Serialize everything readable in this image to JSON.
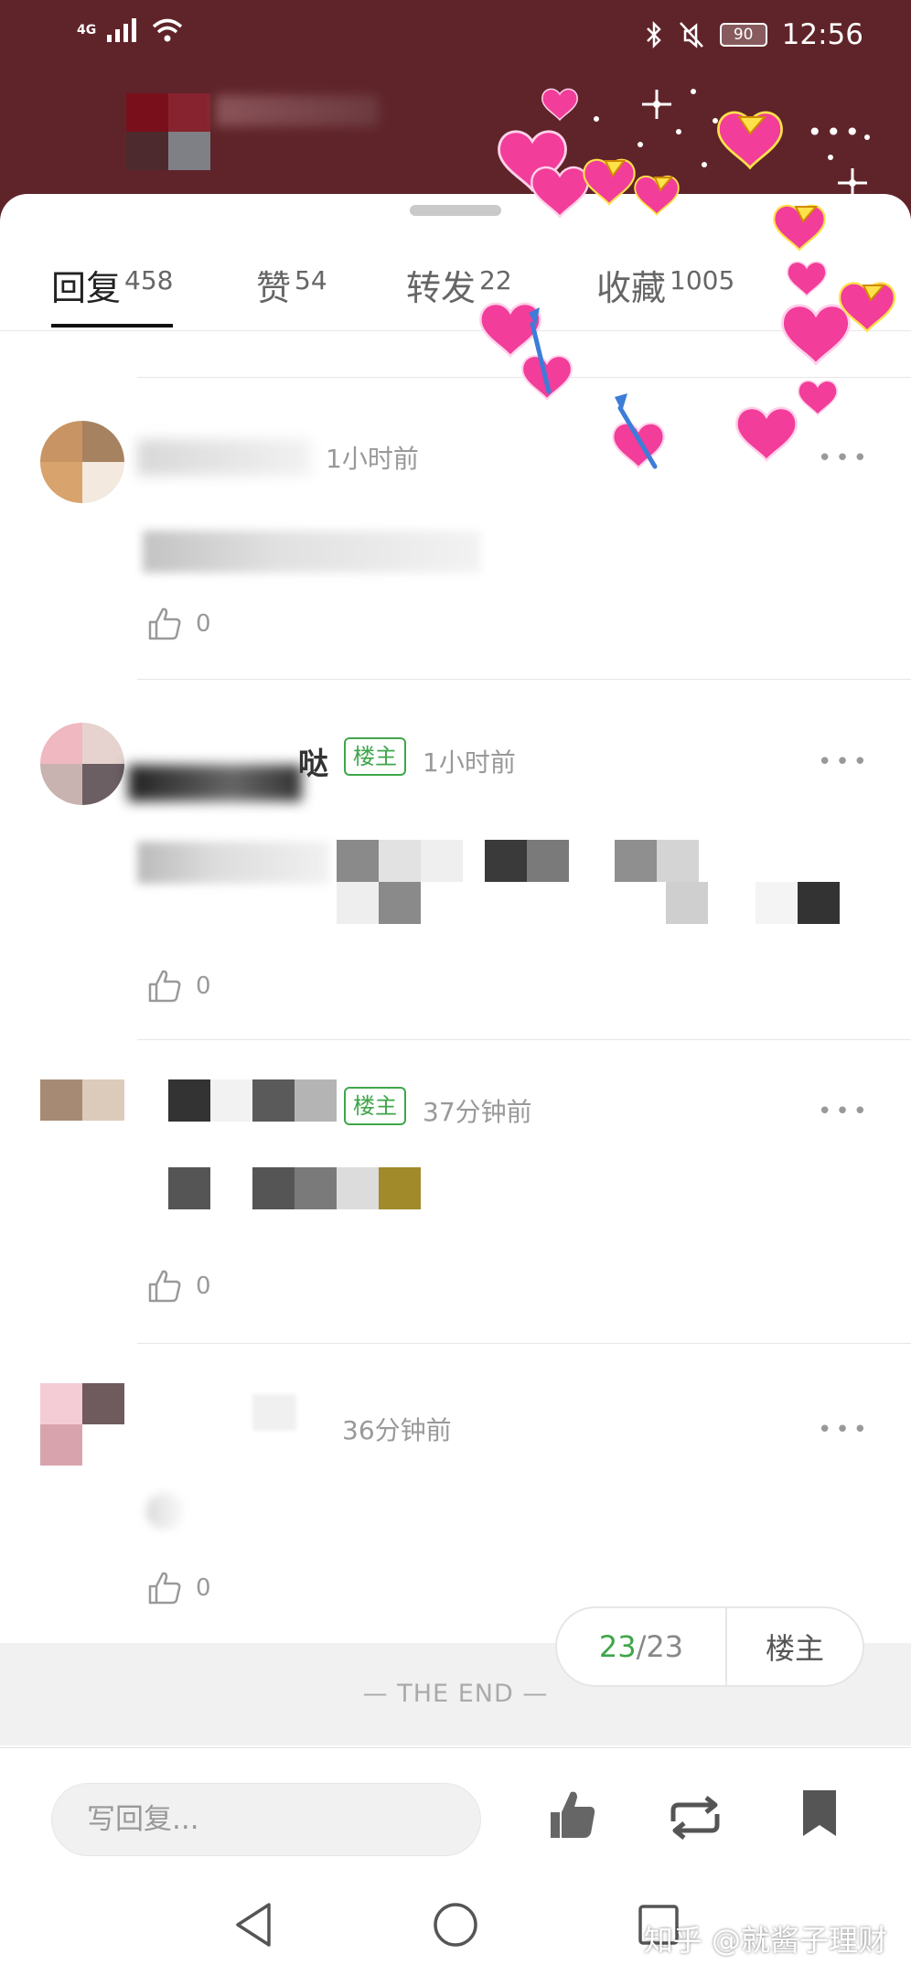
{
  "status_bar": {
    "signal_label": "4G",
    "battery": "90",
    "time": "12:56"
  },
  "tabs": [
    {
      "label": "回复",
      "count": "458"
    },
    {
      "label": "赞",
      "count": "54"
    },
    {
      "label": "转发",
      "count": "22"
    },
    {
      "label": "收藏",
      "count": "1005"
    }
  ],
  "comments": [
    {
      "time": "1小时前",
      "likes": "0"
    },
    {
      "name_tail": "哒",
      "badge": "楼主",
      "time": "1小时前",
      "likes": "0"
    },
    {
      "badge": "楼主",
      "time": "37分钟前",
      "likes": "0"
    },
    {
      "time": "36分钟前",
      "likes": "0"
    }
  ],
  "end_text": "—  THE END  —",
  "float_pill": {
    "current": "23",
    "separator": "/",
    "total": "23",
    "owner_label": "楼主"
  },
  "bottom_bar": {
    "reply_placeholder": "写回复..."
  },
  "watermark": "知乎 @就酱子理财",
  "colors": {
    "header_bg": "#5f2429",
    "accent_green": "#3fa64a",
    "heart_pink": "#f23d9a"
  }
}
